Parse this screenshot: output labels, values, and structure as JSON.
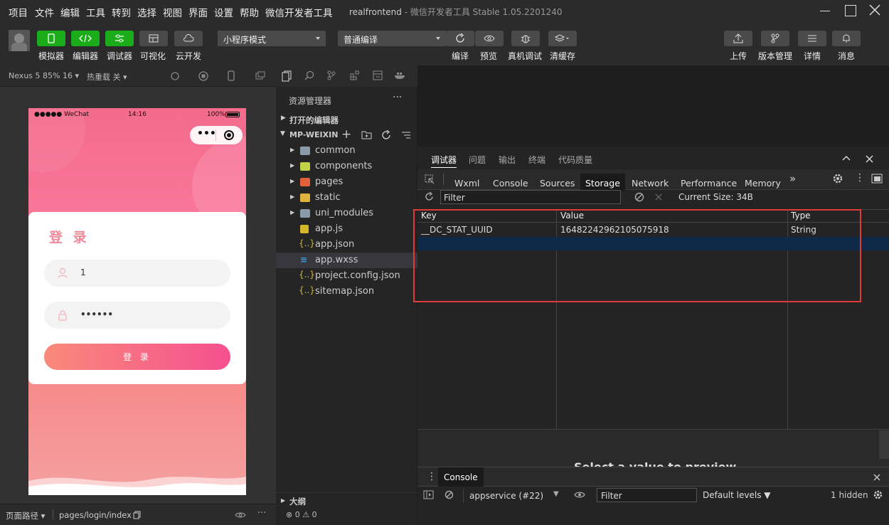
{
  "menu": [
    "项目",
    "文件",
    "编辑",
    "工具",
    "转到",
    "选择",
    "视图",
    "界面",
    "设置",
    "帮助",
    "微信开发者工具"
  ],
  "window": {
    "project": "realfrontend",
    "app": " - 微信开发者工具 Stable 1.05.2201240"
  },
  "toolbar": {
    "left_buttons": [
      "模拟器",
      "编辑器",
      "调试器",
      "可视化",
      "云开发"
    ],
    "mode_select": "小程序模式",
    "compile_select": "普通编译",
    "mid_buttons": [
      "编译",
      "预览",
      "真机调试",
      "清缓存"
    ],
    "right_buttons": [
      "上传",
      "版本管理",
      "详情",
      "消息"
    ]
  },
  "simulator": {
    "device": "Nexus 5 85% 16",
    "reload": "热重载 关",
    "statusbar": {
      "carrier": "●●●●● WeChat",
      "time": "14:16",
      "battery": "100%"
    },
    "login_title": "登 录",
    "username": "1",
    "password": "••••••",
    "login_button": "登 录"
  },
  "explorer": {
    "title": "资源管理器",
    "more": "···",
    "open_editors": "打开的编辑器",
    "project": "MP-WEIXIN",
    "folders": [
      "common",
      "components",
      "pages",
      "static",
      "uni_modules"
    ],
    "files": [
      "app.js",
      "app.json",
      "app.wxss",
      "project.config.json",
      "sitemap.json"
    ],
    "outline": "大纲",
    "problems": "0",
    "warnings": "0"
  },
  "devtools": {
    "top_tabs": [
      "调试器",
      "问题",
      "输出",
      "终端",
      "代码质量"
    ],
    "panel_tabs": [
      "Wxml",
      "Console",
      "Sources",
      "Storage",
      "Network",
      "Performance",
      "Memory"
    ],
    "more_tabs": "»",
    "filter_placeholder": "Filter",
    "current_size": "Current Size: 34B",
    "columns": [
      "Key",
      "Value",
      "Type"
    ],
    "rows": [
      {
        "key": "__DC_STAT_UUID",
        "value": "16482242962105075918",
        "type": "String"
      }
    ],
    "select_hint": "Select a value to preview"
  },
  "console": {
    "tab": "Console",
    "context": "appservice (#22)",
    "filter_placeholder": "Filter",
    "levels": "Default levels",
    "hidden": "1 hidden"
  },
  "status": {
    "page_path_label": "页面路径",
    "page_path": "pages/login/index"
  }
}
